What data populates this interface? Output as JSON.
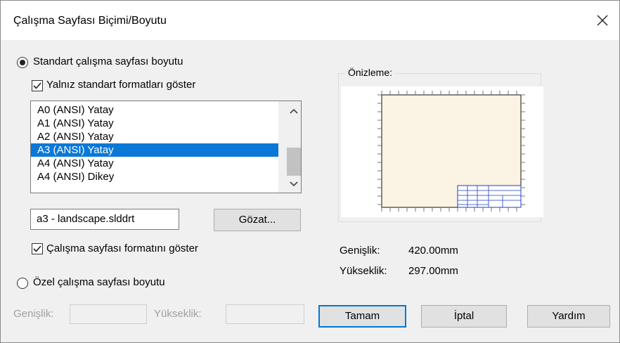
{
  "window": {
    "title": "Çalışma Sayfası Biçimi/Boyutu",
    "close_glyph": "✕"
  },
  "standard": {
    "radio_label": "Standart çalışma sayfası boyutu",
    "selected": true,
    "only_standard_label": "Yalnız standart formatları göster",
    "only_standard_checked": true,
    "sizes": [
      {
        "label": "A0 (ANSI) Yatay",
        "selected": false
      },
      {
        "label": "A1 (ANSI) Yatay",
        "selected": false
      },
      {
        "label": "A2 (ANSI) Yatay",
        "selected": false
      },
      {
        "label": "A3 (ANSI) Yatay",
        "selected": true
      },
      {
        "label": "A4 (ANSI) Yatay",
        "selected": false
      },
      {
        "label": "A4 (ANSI) Dikey",
        "selected": false
      }
    ],
    "format_file": "a3 - landscape.slddrt",
    "browse_label": "Gözat...",
    "show_format_label": "Çalışma sayfası formatını göster",
    "show_format_checked": true
  },
  "custom": {
    "radio_label": "Özel çalışma sayfası boyutu",
    "selected": false,
    "width_label": "Genişlik:",
    "height_label": "Yükseklik:"
  },
  "preview": {
    "legend": "Önizleme:",
    "width_label": "Genişlik:",
    "width_value": "420.00mm",
    "height_label": "Yükseklik:",
    "height_value": "297.00mm",
    "sheet_color": "#fbf3e4"
  },
  "buttons": {
    "ok": "Tamam",
    "cancel": "İptal",
    "help": "Yardım"
  },
  "colors": {
    "selection": "#0a78d7",
    "default_border": "#0078d7"
  }
}
